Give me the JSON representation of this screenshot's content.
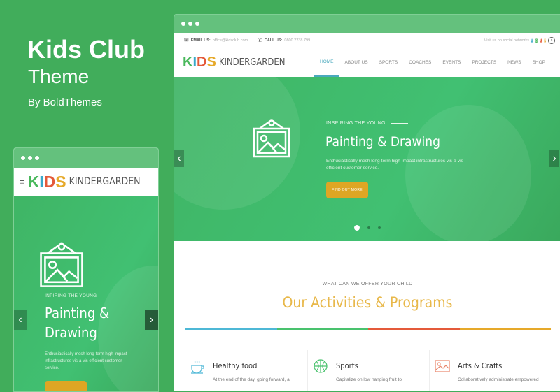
{
  "promo": {
    "title": "Kids Club",
    "subtitle": "Theme",
    "author": "By BoldThemes"
  },
  "desktop": {
    "topbar": {
      "email_label": "EMAIL US:",
      "email": "office@kidsclub.com",
      "call_label": "CALL US:",
      "phone": "0800 2238 799",
      "social_text": "Visit us on social networks"
    },
    "social": [
      {
        "icon": "facebook-icon",
        "glyph": "f",
        "color": "#3aa8c9"
      },
      {
        "icon": "instagram-icon",
        "glyph": "◎",
        "color": "#49b85b"
      },
      {
        "icon": "twitter-icon",
        "glyph": "t",
        "color": "#e45a3a"
      },
      {
        "icon": "pinterest-icon",
        "glyph": "p",
        "color": "#e6a92a"
      }
    ],
    "logo": {
      "k": "K",
      "i": "I",
      "d": "D",
      "s": "S",
      "word": "KINDERGARDEN"
    },
    "menu": [
      "HOME",
      "ABOUT US",
      "SPORTS",
      "COACHES",
      "EVENTS",
      "PROJECTS",
      "NEWS",
      "SHOP"
    ],
    "hero": {
      "kicker": "INSPIRING THE YOUNG",
      "headline": "Painting & Drawing",
      "body": "Enthusiastically mesh long-term high-impact infrastructures vis-a-vis efficient customer service.",
      "button": "FIND OUT MORE",
      "slides": 3,
      "active_slide": 1
    },
    "section": {
      "kicker": "WHAT CAN WE OFFER YOUR CHILD",
      "title": "Our Activities & Programs",
      "stripe_colors": [
        "#4db8d6",
        "#49c26d",
        "#e45a3a",
        "#e6a92a"
      ]
    },
    "features": [
      {
        "title": "Healthy food",
        "text": "At the end of the day, going forward, a",
        "icon": "coffee-cup-icon",
        "color": "#4db8d6"
      },
      {
        "title": "Sports",
        "text": "Capitalize on low hanging fruit to",
        "icon": "basketball-icon",
        "color": "#49c26d"
      },
      {
        "title": "Arts & Crafts",
        "text": "Collaboratively administrate empowered",
        "icon": "picture-icon",
        "color": "#e8856a"
      }
    ]
  },
  "mobile": {
    "logo": {
      "k": "K",
      "i": "I",
      "d": "D",
      "s": "S",
      "word": "KINDERGARDEN"
    },
    "hero": {
      "kicker": "INPIRING THE YOUNG",
      "headline_line1": "Painting &",
      "headline_line2": "Drawing",
      "body": "Enthusiastically mesh long-term high-impact infrastructures vis-a-vis efficient customer service."
    }
  }
}
